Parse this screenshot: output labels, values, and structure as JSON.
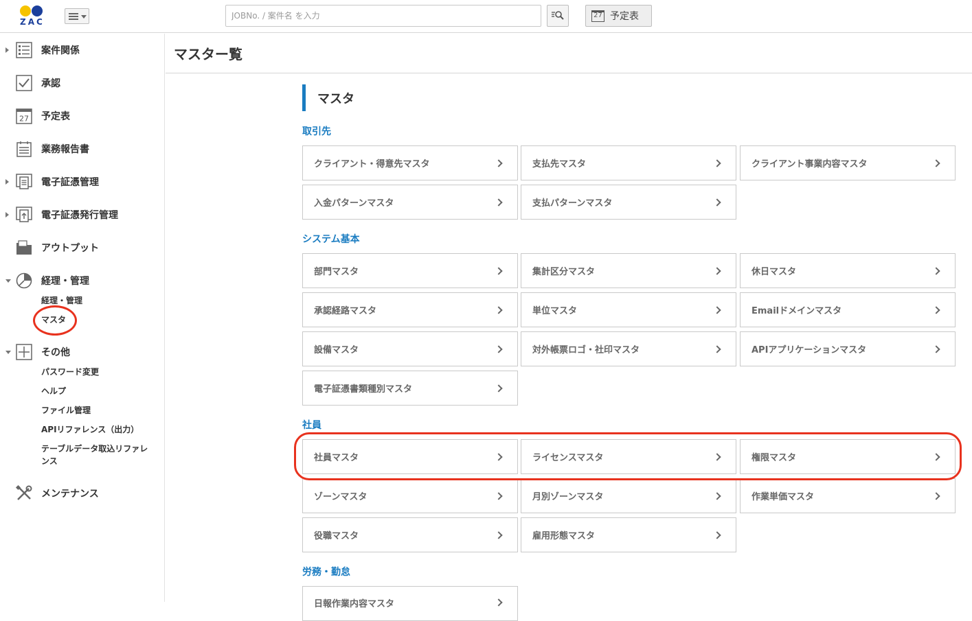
{
  "header": {
    "logo_text": "ZAC",
    "search_placeholder": "JOBNo. / 案件名 を入力",
    "schedule_label": "予定表",
    "calendar_day": "27"
  },
  "sidebar": {
    "items": [
      {
        "label": "案件関係",
        "icon": "list-icon"
      },
      {
        "label": "承認",
        "icon": "checkbox-icon"
      },
      {
        "label": "予定表",
        "icon": "calendar-icon",
        "day": "27"
      },
      {
        "label": "業務報告書",
        "icon": "report-icon"
      },
      {
        "label": "電子証憑管理",
        "icon": "document-icon"
      },
      {
        "label": "電子証憑発行管理",
        "icon": "document-upload-icon"
      },
      {
        "label": "アウトプット",
        "icon": "folder-icon"
      },
      {
        "label": "経理・管理",
        "icon": "pie-chart-icon",
        "subitems": [
          "経理・管理",
          "マスタ"
        ]
      },
      {
        "label": "その他",
        "icon": "plus-box-icon",
        "subitems": [
          "パスワード変更",
          "ヘルプ",
          "ファイル管理",
          "APIリファレンス（出力）",
          "テーブルデータ取込リファレ",
          "ンス"
        ]
      },
      {
        "label": "メンテナンス",
        "icon": "tools-icon"
      }
    ]
  },
  "main": {
    "page_title": "マスター覧",
    "section_title": "マスタ",
    "groups": [
      {
        "title": "取引先",
        "cards": [
          "クライアント・得意先マスタ",
          "支払先マスタ",
          "クライアント事業内容マスタ",
          "入金パターンマスタ",
          "支払パターンマスタ"
        ]
      },
      {
        "title": "システム基本",
        "cards": [
          "部門マスタ",
          "集計区分マスタ",
          "休日マスタ",
          "承認経路マスタ",
          "単位マスタ",
          "Emailドメインマスタ",
          "設備マスタ",
          "対外帳票ロゴ・社印マスタ",
          "APIアプリケーションマスタ",
          "電子証憑書類種別マスタ"
        ]
      },
      {
        "title": "社員",
        "cards": [
          "社員マスタ",
          "ライセンスマスタ",
          "権限マスタ",
          "ゾーンマスタ",
          "月別ゾーンマスタ",
          "作業単価マスタ",
          "役職マスタ",
          "雇用形態マスタ"
        ]
      },
      {
        "title": "労務・勤怠",
        "cards": [
          "日報作業内容マスタ"
        ]
      }
    ]
  },
  "colors": {
    "accent": "#1a7cc1",
    "highlight": "#e8321e",
    "logo_yellow": "#f6c300",
    "logo_blue": "#1b3f9b"
  }
}
